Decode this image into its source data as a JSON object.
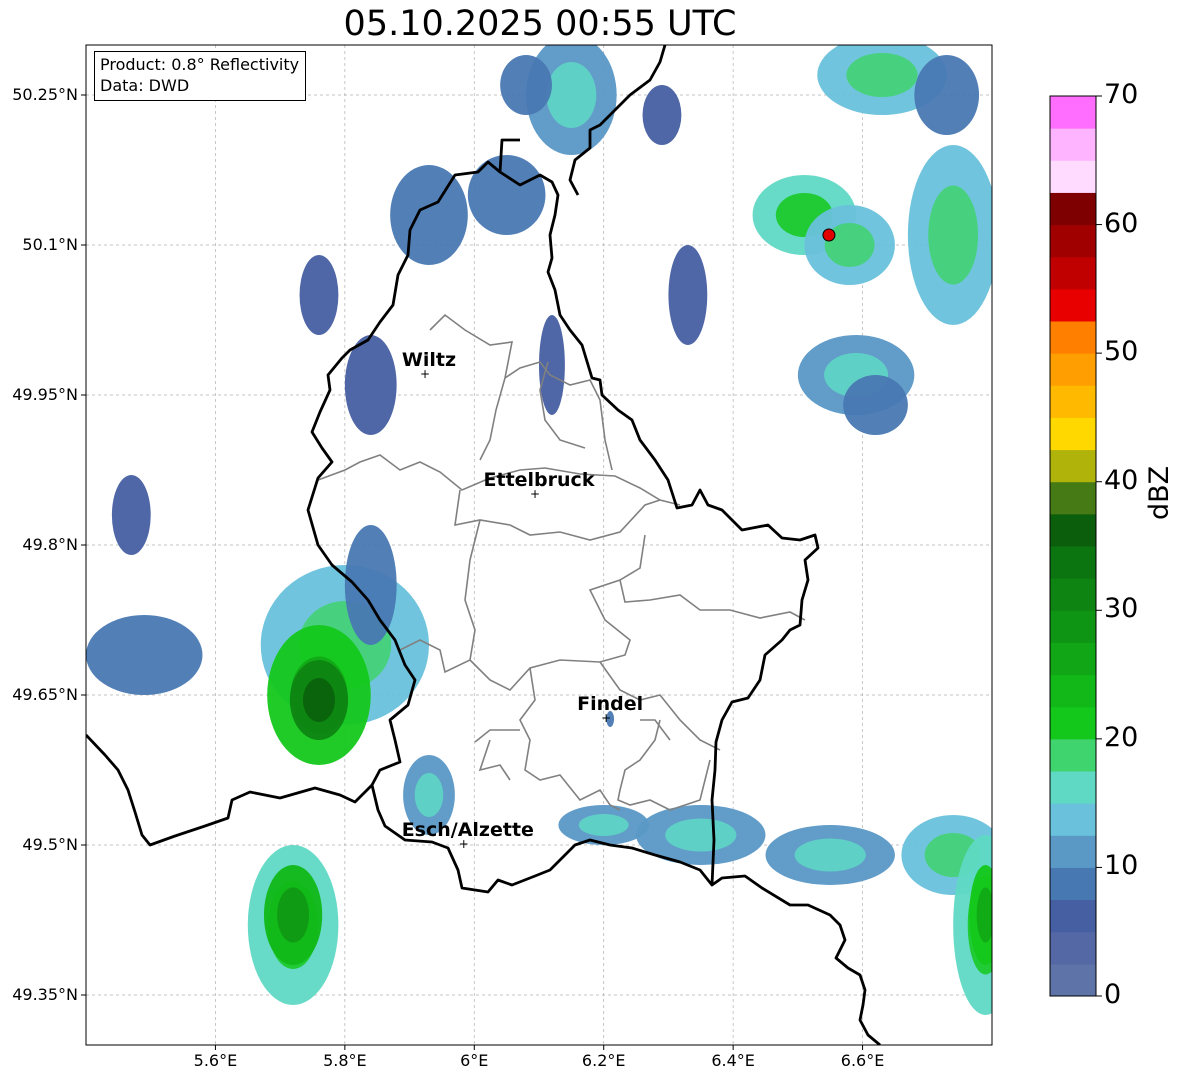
{
  "title": "05.10.2025 00:55 UTC",
  "info": {
    "product": "Product: 0.8° Reflectivity",
    "data": "Data: DWD"
  },
  "map": {
    "lon_range": [
      5.4,
      6.8
    ],
    "lat_range": [
      49.3,
      50.3
    ],
    "lon_ticks": [
      {
        "value": 5.6,
        "label": "5.6°E"
      },
      {
        "value": 5.8,
        "label": "5.8°E"
      },
      {
        "value": 6.0,
        "label": "6°E"
      },
      {
        "value": 6.2,
        "label": "6.2°E"
      },
      {
        "value": 6.4,
        "label": "6.4°E"
      },
      {
        "value": 6.6,
        "label": "6.6°E"
      }
    ],
    "lat_ticks": [
      {
        "value": 50.25,
        "label": "50.25°N"
      },
      {
        "value": 50.1,
        "label": "50.1°N"
      },
      {
        "value": 49.95,
        "label": "49.95°N"
      },
      {
        "value": 49.8,
        "label": "49.8°N"
      },
      {
        "value": 49.65,
        "label": "49.65°N"
      },
      {
        "value": 49.5,
        "label": "49.5°N"
      },
      {
        "value": 49.35,
        "label": "49.35°N"
      }
    ],
    "cities": [
      {
        "name": "Wiltz",
        "lon": 5.93,
        "lat": 49.97
      },
      {
        "name": "Ettelbruck",
        "lon": 6.1,
        "lat": 49.85
      },
      {
        "name": "Findel",
        "lon": 6.21,
        "lat": 49.626
      },
      {
        "name": "Esch/Alzette",
        "lon": 5.99,
        "lat": 49.5
      }
    ],
    "radar_site": {
      "lon": 6.548,
      "lat": 50.11,
      "color": "#e00000"
    },
    "grid": true
  },
  "colorbar": {
    "label": "dBZ",
    "min": 0,
    "max": 70,
    "step": 2.5,
    "ticks": [
      0,
      10,
      20,
      30,
      40,
      50,
      60,
      70
    ],
    "colors": [
      "#5e73a8",
      "#5368a4",
      "#465fa2",
      "#4878b2",
      "#5a98c6",
      "#69c1db",
      "#5fd9c4",
      "#3fd46d",
      "#14c81b",
      "#11b817",
      "#10a615",
      "#0f9514",
      "#0e8512",
      "#0b7510",
      "#0b5e0b",
      "#457a14",
      "#b0b40a",
      "#ffd800",
      "#ffba00",
      "#ff9e00",
      "#ff7f00",
      "#e80000",
      "#c00000",
      "#a00000",
      "#7f0000",
      "#ffdcff",
      "#ffb4ff",
      "#ff6eff",
      "#ee3cee"
    ]
  },
  "echoes": [
    {
      "lon": 5.84,
      "lat": 49.96,
      "rx": 0.04,
      "ry": 0.05,
      "dbz": 5
    },
    {
      "lon": 5.76,
      "lat": 50.05,
      "rx": 0.03,
      "ry": 0.04,
      "dbz": 6
    },
    {
      "lon": 5.93,
      "lat": 50.13,
      "rx": 0.06,
      "ry": 0.05,
      "dbz": 8
    },
    {
      "lon": 6.05,
      "lat": 50.15,
      "rx": 0.06,
      "ry": 0.04,
      "dbz": 9
    },
    {
      "lon": 6.15,
      "lat": 50.25,
      "rx": 0.07,
      "ry": 0.06,
      "dbz": 10
    },
    {
      "lon": 6.08,
      "lat": 50.26,
      "rx": 0.04,
      "ry": 0.03,
      "dbz": 8
    },
    {
      "lon": 6.29,
      "lat": 50.23,
      "rx": 0.03,
      "ry": 0.03,
      "dbz": 6
    },
    {
      "lon": 6.33,
      "lat": 50.05,
      "rx": 0.03,
      "ry": 0.05,
      "dbz": 7
    },
    {
      "lon": 6.63,
      "lat": 50.27,
      "rx": 0.1,
      "ry": 0.04,
      "dbz": 14
    },
    {
      "lon": 6.73,
      "lat": 50.25,
      "rx": 0.05,
      "ry": 0.04,
      "dbz": 8
    },
    {
      "lon": 6.51,
      "lat": 50.13,
      "rx": 0.08,
      "ry": 0.04,
      "dbz": 15
    },
    {
      "lon": 6.58,
      "lat": 50.1,
      "rx": 0.07,
      "ry": 0.04,
      "dbz": 13
    },
    {
      "lon": 6.74,
      "lat": 50.11,
      "rx": 0.07,
      "ry": 0.09,
      "dbz": 14
    },
    {
      "lon": 6.59,
      "lat": 49.97,
      "rx": 0.09,
      "ry": 0.04,
      "dbz": 11
    },
    {
      "lon": 6.62,
      "lat": 49.94,
      "rx": 0.05,
      "ry": 0.03,
      "dbz": 9
    },
    {
      "lon": 6.12,
      "lat": 49.98,
      "rx": 0.02,
      "ry": 0.05,
      "dbz": 6
    },
    {
      "lon": 5.47,
      "lat": 49.83,
      "rx": 0.03,
      "ry": 0.04,
      "dbz": 6
    },
    {
      "lon": 5.49,
      "lat": 49.69,
      "rx": 0.09,
      "ry": 0.04,
      "dbz": 8
    },
    {
      "lon": 5.8,
      "lat": 49.7,
      "rx": 0.13,
      "ry": 0.08,
      "dbz": 14
    },
    {
      "lon": 5.76,
      "lat": 49.65,
      "rx": 0.08,
      "ry": 0.07,
      "dbz": 22
    },
    {
      "lon": 5.76,
      "lat": 49.645,
      "rx": 0.045,
      "ry": 0.04,
      "dbz": 30
    },
    {
      "lon": 5.84,
      "lat": 49.76,
      "rx": 0.04,
      "ry": 0.06,
      "dbz": 8
    },
    {
      "lon": 5.93,
      "lat": 49.55,
      "rx": 0.04,
      "ry": 0.04,
      "dbz": 12
    },
    {
      "lon": 6.2,
      "lat": 49.52,
      "rx": 0.07,
      "ry": 0.02,
      "dbz": 10
    },
    {
      "lon": 6.35,
      "lat": 49.51,
      "rx": 0.1,
      "ry": 0.03,
      "dbz": 11
    },
    {
      "lon": 6.55,
      "lat": 49.49,
      "rx": 0.1,
      "ry": 0.03,
      "dbz": 10
    },
    {
      "lon": 6.74,
      "lat": 49.49,
      "rx": 0.08,
      "ry": 0.04,
      "dbz": 13
    },
    {
      "lon": 6.79,
      "lat": 49.42,
      "rx": 0.05,
      "ry": 0.09,
      "dbz": 16
    },
    {
      "lon": 6.79,
      "lat": 49.43,
      "rx": 0.025,
      "ry": 0.05,
      "dbz": 22
    },
    {
      "lon": 5.72,
      "lat": 49.42,
      "rx": 0.07,
      "ry": 0.08,
      "dbz": 16
    },
    {
      "lon": 5.72,
      "lat": 49.43,
      "rx": 0.045,
      "ry": 0.05,
      "dbz": 23
    },
    {
      "lon": 6.21,
      "lat": 49.626,
      "rx": 0.006,
      "ry": 0.008,
      "dbz": 8
    }
  ]
}
